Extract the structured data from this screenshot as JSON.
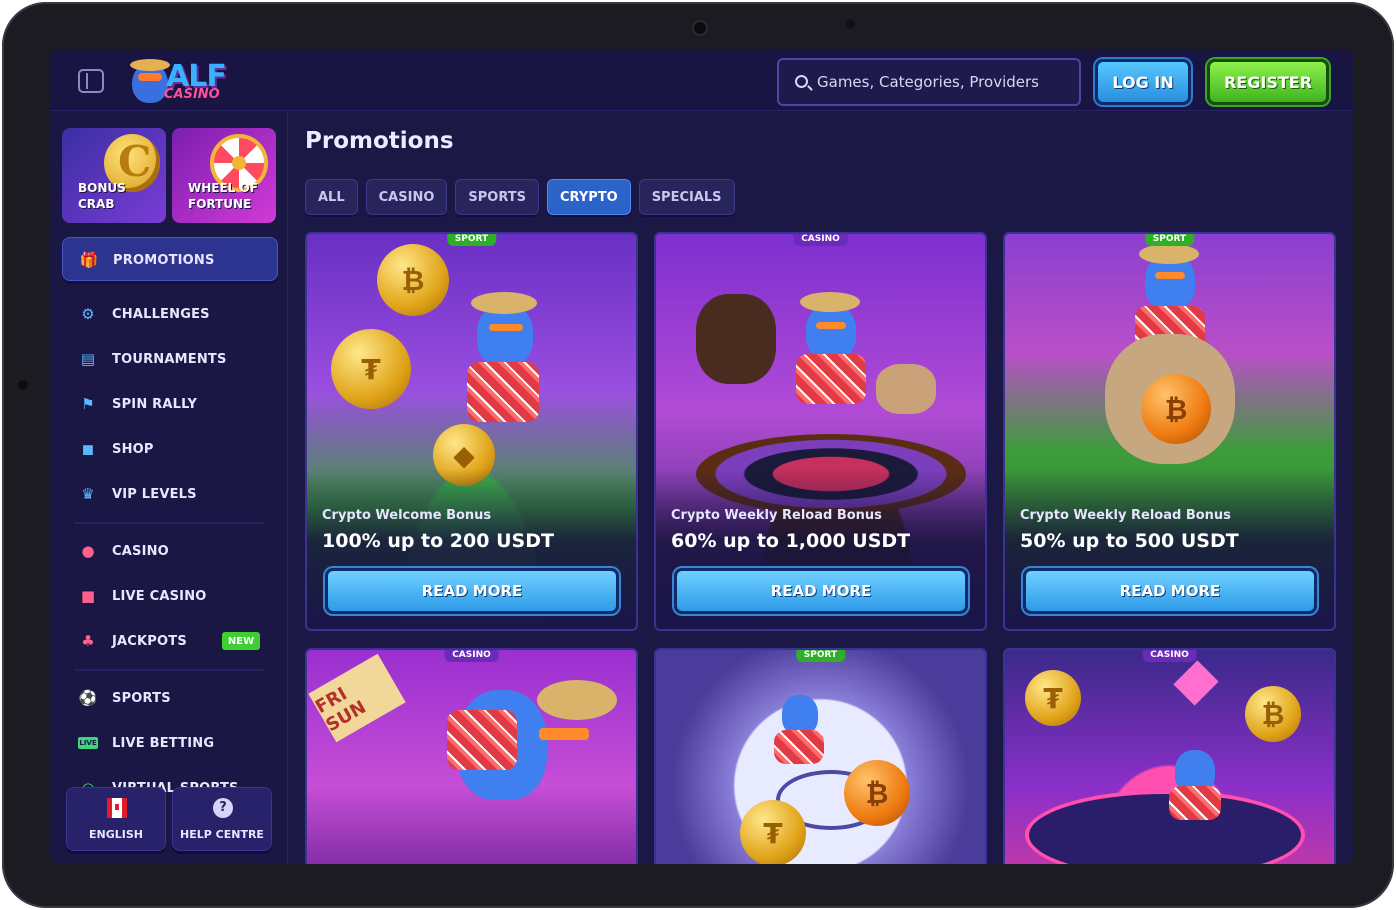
{
  "header": {
    "logo_alt": "ALF CASINO",
    "logo_main": "ALF",
    "logo_sub": "CASINO",
    "search_placeholder": "Games, Categories, Providers",
    "login_label": "LOG IN",
    "register_label": "REGISTER"
  },
  "sidebar": {
    "tiles": [
      {
        "line1": "BONUS",
        "line2": "CRAB"
      },
      {
        "line1": "WHEEL OF",
        "line2": "FORTUNE"
      }
    ],
    "promotions_label": "PROMOTIONS",
    "items": [
      {
        "label": "CHALLENGES",
        "icon": "trophy-icon"
      },
      {
        "label": "TOURNAMENTS",
        "icon": "podium-icon"
      },
      {
        "label": "SPIN RALLY",
        "icon": "flag-icon"
      },
      {
        "label": "SHOP",
        "icon": "shopping-bag-icon"
      },
      {
        "label": "VIP LEVELS",
        "icon": "crown-icon"
      },
      {
        "label": "CASINO",
        "icon": "cherry-icon"
      },
      {
        "label": "LIVE CASINO",
        "icon": "live-cards-icon"
      },
      {
        "label": "JACKPOTS",
        "icon": "clover-icon",
        "badge": "NEW"
      },
      {
        "label": "SPORTS",
        "icon": "soccer-ball-icon"
      },
      {
        "label": "LIVE BETTING",
        "icon": "live-icon",
        "icon_text": "LIVE"
      },
      {
        "label": "VIRTUAL SPORTS",
        "icon": "virtual-sports-icon"
      }
    ],
    "bottom": {
      "language_label": "ENGLISH",
      "help_label": "HELP CENTRE",
      "help_glyph": "?"
    }
  },
  "main": {
    "title": "Promotions",
    "tabs": [
      "ALL",
      "CASINO",
      "SPORTS",
      "CRYPTO",
      "SPECIALS"
    ],
    "active_tab": "CRYPTO",
    "cards": [
      {
        "tag": "SPORT",
        "subtitle": "Crypto Welcome Bonus",
        "title": "100% up to 200 USDT",
        "button": "READ MORE"
      },
      {
        "tag": "CASINO",
        "subtitle": "Crypto Weekly Reload Bonus",
        "title": "60% up to 1,000 USDT",
        "button": "READ MORE"
      },
      {
        "tag": "SPORT",
        "subtitle": "Crypto Weekly Reload Bonus",
        "title": "50% up to 500 USDT",
        "button": "READ MORE"
      },
      {
        "tag": "CASINO"
      },
      {
        "tag": "SPORT"
      },
      {
        "tag": "CASINO"
      }
    ],
    "sign_text": "FRI SUN"
  },
  "colors": {
    "background": "#1c1845",
    "sidebar": "#1b1744",
    "active_tab": "#2b63c8",
    "login": "#3aa9f2",
    "register": "#5bd133",
    "new_badge": "#3fcf33"
  }
}
